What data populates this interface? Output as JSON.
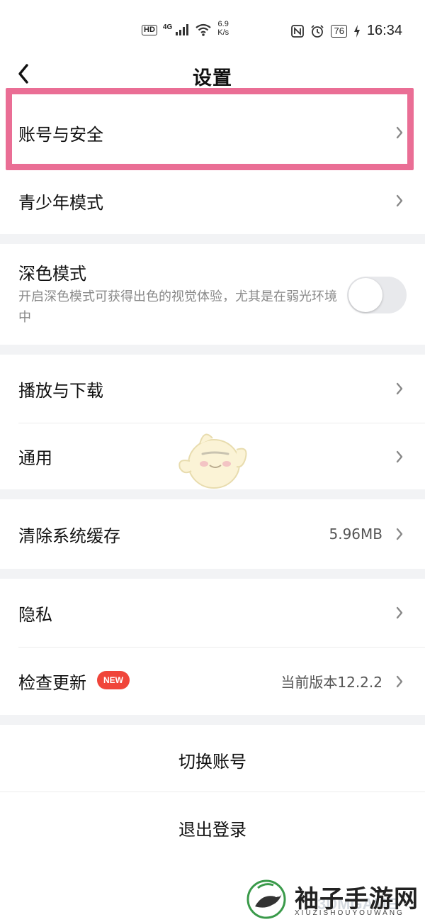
{
  "status_bar": {
    "hd": "HD",
    "network": "4G",
    "speed_value": "6.9",
    "speed_unit": "K/s",
    "battery": "76",
    "time": "16:34"
  },
  "header": {
    "title": "设置"
  },
  "settings": {
    "account_security": "账号与安全",
    "teen_mode": "青少年模式",
    "dark_mode": {
      "label": "深色模式",
      "description": "开启深色模式可获得出色的视觉体验，尤其是在弱光环境中",
      "enabled": false
    },
    "playback_download": "播放与下载",
    "general": "通用",
    "clear_cache": {
      "label": "清除系统缓存",
      "value": "5.96MB"
    },
    "privacy": "隐私",
    "check_update": {
      "label": "检查更新",
      "badge": "NEW",
      "value": "当前版本12.2.2"
    }
  },
  "actions": {
    "switch_account": "切换账号",
    "logout": "退出登录"
  },
  "watermark": {
    "title": "袖子手游网",
    "subtitle": "XIUZISHOUYOUWANG",
    "overlay": "3DMGAME"
  },
  "colors": {
    "highlight": "#ea6e95",
    "badge": "#f0453a",
    "section_gap": "#f2f3f5"
  },
  "icons": [
    "back-arrow-icon",
    "chevron-right-icon",
    "hd-icon",
    "signal-icon",
    "wifi-icon",
    "nfc-icon",
    "alarm-icon",
    "battery-icon",
    "charging-icon",
    "mascot-icon",
    "bird-logo-icon"
  ]
}
